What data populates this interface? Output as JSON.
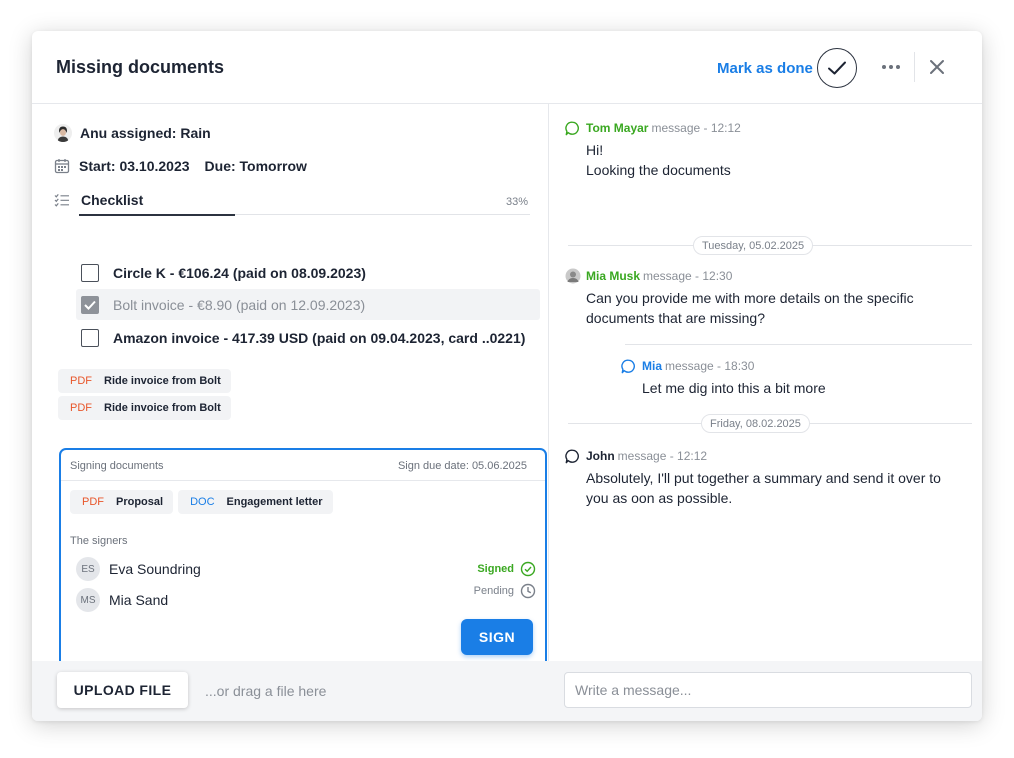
{
  "header": {
    "title": "Missing documents",
    "mark_done": "Mark as done"
  },
  "task": {
    "assigned": "Anu assigned: Rain",
    "start": "Start: 03.10.2023",
    "due": "Due: Tomorrow"
  },
  "checklist": {
    "label": "Checklist",
    "progress_text": "33%",
    "progress": 0.33,
    "items": [
      {
        "label": "Circle K - €106.24 (paid on 08.09.2023)",
        "checked": false
      },
      {
        "label": "Bolt invoice - €8.90 (paid on 12.09.2023)",
        "checked": true
      },
      {
        "label": "Amazon invoice - 417.39 USD (paid on 09.04.2023, card ..0221)",
        "checked": false
      }
    ]
  },
  "attachments": [
    {
      "type": "PDF",
      "name": "Ride invoice from Bolt"
    },
    {
      "type": "PDF",
      "name": "Ride invoice from Bolt"
    }
  ],
  "signing": {
    "title": "Signing documents",
    "due": "Sign due date: 05.06.2025",
    "documents": [
      {
        "type": "PDF",
        "name": "Proposal"
      },
      {
        "type": "DOC",
        "name": "Engagement letter"
      }
    ],
    "signers_label": "The signers",
    "signers": [
      {
        "initials": "ES",
        "name": "Eva Soundring",
        "status": "Signed"
      },
      {
        "initials": "MS",
        "name": "Mia Sand",
        "status": "Pending"
      }
    ],
    "sign_button": "SIGN"
  },
  "footer": {
    "upload": "UPLOAD FILE",
    "drag_hint": "...or drag a file here",
    "message_placeholder": "Write a message..."
  },
  "chat": {
    "messages": [
      {
        "author": "Tom Mayar",
        "meta": "message - 12:12",
        "lines": [
          "Hi!",
          "Looking the documents"
        ]
      },
      {
        "author": "Mia Musk",
        "meta": "message  - 12:30",
        "lines": [
          "Can you provide me with more details on the specific",
          "documents that are missing?"
        ]
      },
      {
        "author": "Mia",
        "meta": "message - 18:30",
        "lines": [
          "Let me dig into this a bit more"
        ]
      },
      {
        "author": "John",
        "meta": "message - 12:12",
        "lines": [
          "Absolutely, I'll put together a summary and send it over to",
          "you as oon as possible."
        ]
      }
    ],
    "separators": [
      "Tuesday, 05.02.2025",
      "Friday, 08.02.2025"
    ]
  },
  "colors": {
    "accent": "#1a7ee6",
    "success": "#3aa821",
    "pdf": "#e8562a",
    "text": "#1d2433",
    "muted": "#8a8f97"
  },
  "icons": [
    "check-icon",
    "more-icon",
    "close-icon",
    "calendar-icon",
    "checklist-icon",
    "signed-check-icon",
    "pending-clock-icon",
    "chat-bubble-icon"
  ]
}
